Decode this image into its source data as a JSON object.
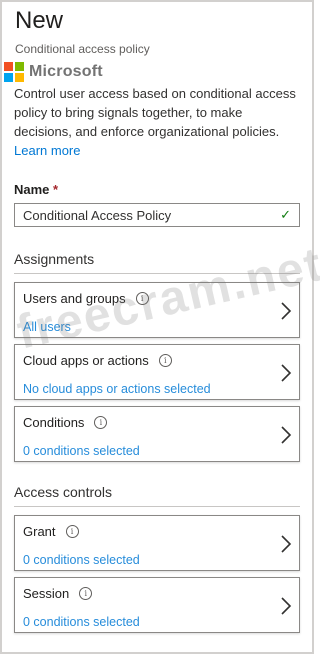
{
  "header": {
    "title": "New",
    "subtitle": "Conditional access policy"
  },
  "brand": {
    "name": "Microsoft",
    "logo_colors": [
      "#f25022",
      "#7fba00",
      "#00a4ef",
      "#ffb900"
    ]
  },
  "description": {
    "text": "Control user access based on conditional access policy to bring signals together, to make decisions, and enforce organizational policies. ",
    "link": "Learn more"
  },
  "name_field": {
    "label": "Name",
    "required_marker": "*",
    "value": "Conditional Access  Policy",
    "valid_icon": "check-icon"
  },
  "assignments": {
    "heading": "Assignments",
    "cards": [
      {
        "title": "Users and groups",
        "value": "All users"
      },
      {
        "title": "Cloud apps or actions",
        "value": "No cloud apps or actions selected"
      },
      {
        "title": "Conditions",
        "value": "0 conditions selected"
      }
    ]
  },
  "access_controls": {
    "heading": "Access controls",
    "cards": [
      {
        "title": "Grant",
        "value": "0 conditions selected"
      },
      {
        "title": "Session",
        "value": "0 conditions selected"
      }
    ]
  },
  "watermark": "freecram.net",
  "colors": {
    "accent": "#0078d4",
    "success": "#107c10",
    "required": "#a4262c"
  }
}
